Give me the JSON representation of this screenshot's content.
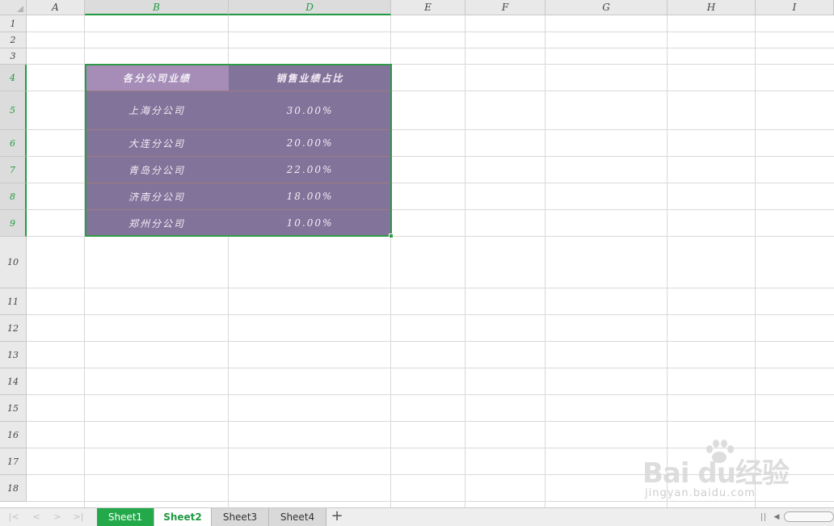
{
  "columns": [
    "A",
    "B",
    "D",
    "E",
    "F",
    "G",
    "H",
    "I"
  ],
  "rows": [
    "1",
    "2",
    "3",
    "4",
    "5",
    "6",
    "7",
    "8",
    "9",
    "10",
    "11",
    "12",
    "13",
    "14",
    "15",
    "16",
    "17",
    "18"
  ],
  "table": {
    "headers": [
      "各分公司业绩",
      "销售业绩占比"
    ],
    "rows": [
      [
        "上海分公司",
        "30.00%"
      ],
      [
        "大连分公司",
        "20.00%"
      ],
      [
        "青岛分公司",
        "22.00%"
      ],
      [
        "济南分公司",
        "18.00%"
      ],
      [
        "郑州分公司",
        "10.00%"
      ]
    ]
  },
  "sheets": [
    "Sheet1",
    "Sheet2",
    "Sheet3",
    "Sheet4"
  ],
  "active_sheet": "Sheet2",
  "add_sheet_label": "+",
  "nav_icons": [
    "first-sheet-icon",
    "prev-sheet-icon",
    "next-sheet-icon",
    "last-sheet-icon"
  ],
  "watermark": {
    "brand": "Bai du经验",
    "url": "jingyan.baidu.com"
  },
  "colors": {
    "table_body": "#82739a",
    "table_header_b": "#a58db8",
    "selection_border": "#2e9a48",
    "active_tab_text": "#1f9a43",
    "sheet1_tab_bg": "#23a94a"
  }
}
